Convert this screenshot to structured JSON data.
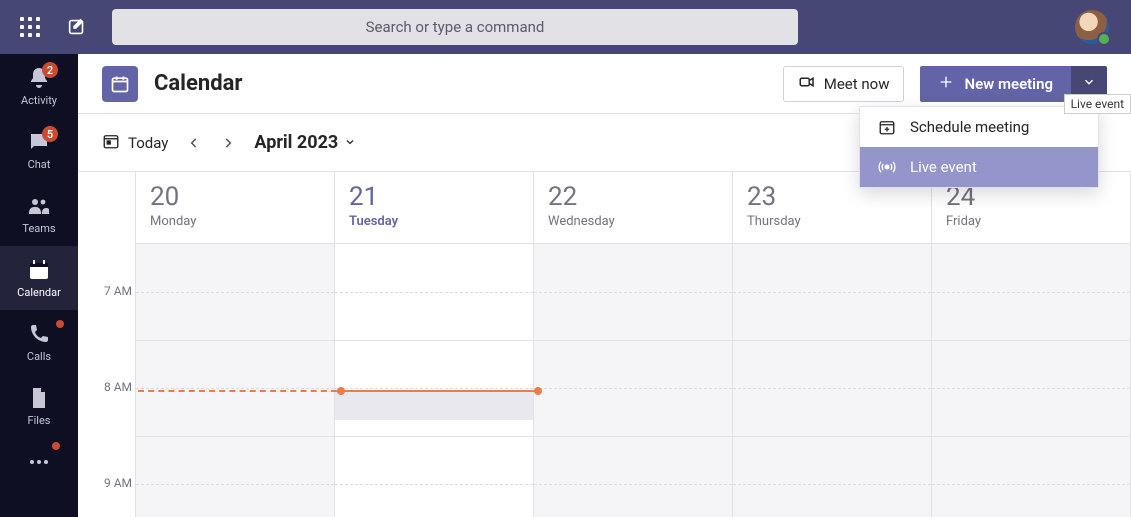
{
  "search": {
    "placeholder": "Search or type a command"
  },
  "rail": {
    "items": [
      {
        "label": "Activity",
        "icon": "bell-icon",
        "badge": "2"
      },
      {
        "label": "Chat",
        "icon": "chat-icon",
        "badge": "5"
      },
      {
        "label": "Teams",
        "icon": "teams-icon"
      },
      {
        "label": "Calendar",
        "icon": "calendar-icon",
        "active": true
      },
      {
        "label": "Calls",
        "icon": "phone-icon",
        "dot": true
      },
      {
        "label": "Files",
        "icon": "file-icon"
      }
    ],
    "more_dot": true
  },
  "header": {
    "title": "Calendar",
    "meet_now": "Meet now",
    "new_meeting": "New meeting"
  },
  "nav": {
    "today": "Today",
    "month": "April 2023"
  },
  "menu": {
    "items": [
      {
        "label": "Schedule meeting",
        "icon": "calendar-plus-icon"
      },
      {
        "label": "Live event",
        "icon": "broadcast-icon",
        "hover": true
      }
    ]
  },
  "tooltip": "Live event",
  "times": [
    "7 AM",
    "8 AM",
    "9 AM"
  ],
  "days": [
    {
      "num": "20",
      "name": "Monday"
    },
    {
      "num": "21",
      "name": "Tuesday",
      "today": true
    },
    {
      "num": "22",
      "name": "Wednesday"
    },
    {
      "num": "23",
      "name": "Thursday"
    },
    {
      "num": "24",
      "name": "Friday"
    }
  ]
}
